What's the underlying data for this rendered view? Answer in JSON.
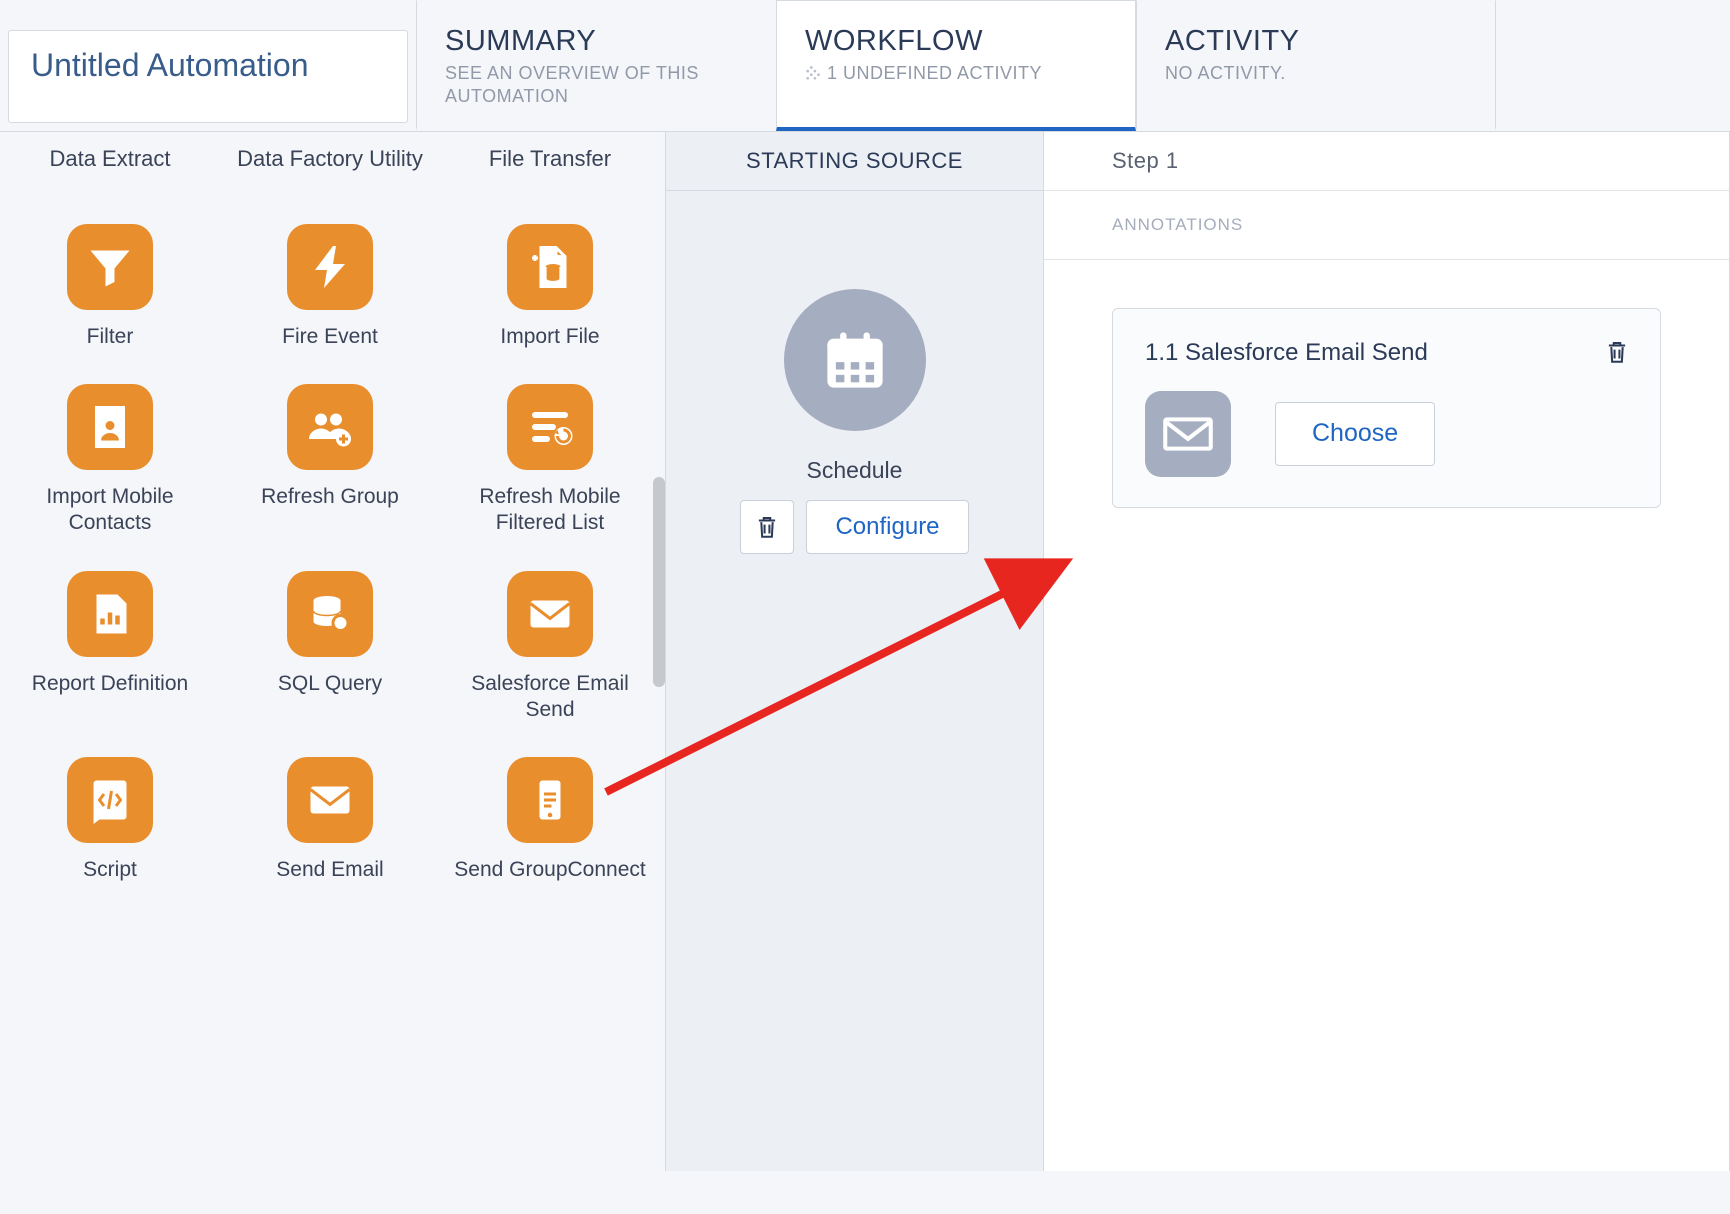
{
  "title": "Untitled Automation",
  "tabs": {
    "summary": {
      "title": "SUMMARY",
      "sub": "SEE AN OVERVIEW OF THIS AUTOMATION"
    },
    "workflow": {
      "title": "WORKFLOW",
      "sub": "1 UNDEFINED ACTIVITY"
    },
    "activity": {
      "title": "ACTIVITY",
      "sub": "NO ACTIVITY."
    }
  },
  "palette_headers": [
    "Data Extract",
    "Data Factory Utility",
    "File Transfer"
  ],
  "palette": [
    {
      "icon": "funnel",
      "label": "Filter"
    },
    {
      "icon": "bolt",
      "label": "Fire Event"
    },
    {
      "icon": "dbplus",
      "label": "Import File"
    },
    {
      "icon": "contact",
      "label": "Import Mobile Contacts"
    },
    {
      "icon": "group",
      "label": "Refresh Group"
    },
    {
      "icon": "listrefresh",
      "label": "Refresh Mobile Filtered List"
    },
    {
      "icon": "report",
      "label": "Report Definition"
    },
    {
      "icon": "dbsearch",
      "label": "SQL Query"
    },
    {
      "icon": "envelope",
      "label": "Salesforce Email Send"
    },
    {
      "icon": "script",
      "label": "Script"
    },
    {
      "icon": "envelope",
      "label": "Send Email"
    },
    {
      "icon": "mobile",
      "label": "Send GroupConnect"
    }
  ],
  "source": {
    "header": "STARTING SOURCE",
    "label": "Schedule",
    "configure": "Configure"
  },
  "step": {
    "header": "Step 1",
    "annotations": "ANNOTATIONS",
    "card_title": "1.1 Salesforce Email Send",
    "choose": "Choose"
  }
}
